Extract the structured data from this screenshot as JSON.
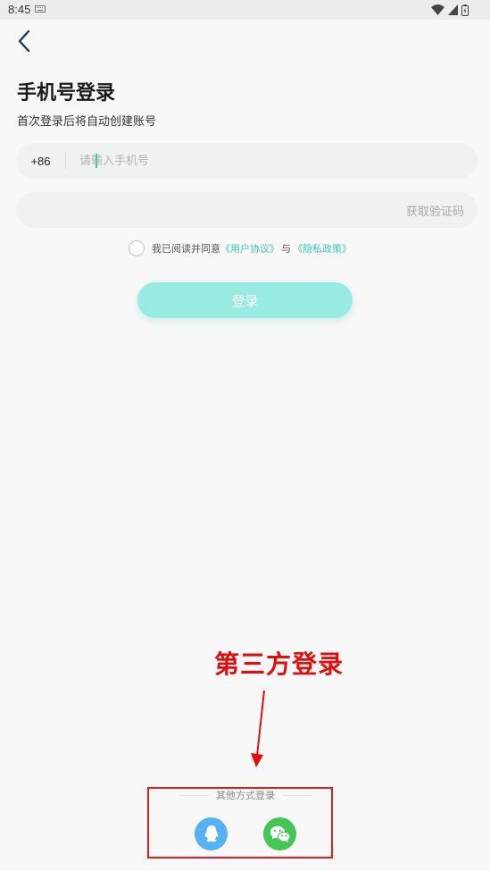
{
  "status_bar": {
    "time": "8:45"
  },
  "header": {
    "back_icon": "chevron-left-icon"
  },
  "page": {
    "title": "手机号登录",
    "subtitle": "首次登录后将自动创建账号"
  },
  "phone": {
    "country_code": "+86",
    "placeholder": "请输入手机号",
    "value": ""
  },
  "code": {
    "get_code_label": "获取验证码",
    "value": ""
  },
  "agreement": {
    "prefix": "我已阅读并同意",
    "user_agreement": "《用户协议》",
    "conjunction": "与",
    "privacy_policy": "《隐私政策》",
    "checked": false
  },
  "login_button": {
    "label": "登录"
  },
  "annotation": {
    "text": "第三方登录",
    "color": "#e20d0d"
  },
  "other_login": {
    "label": "其他方式登录",
    "options": [
      {
        "icon": "qq-icon",
        "color": "#57b1f5"
      },
      {
        "icon": "wechat-icon",
        "color": "#43c653"
      }
    ]
  },
  "colors": {
    "accent": "#3ccab6",
    "button_disabled": "#98ebe0",
    "background": "#f8f8f8"
  }
}
